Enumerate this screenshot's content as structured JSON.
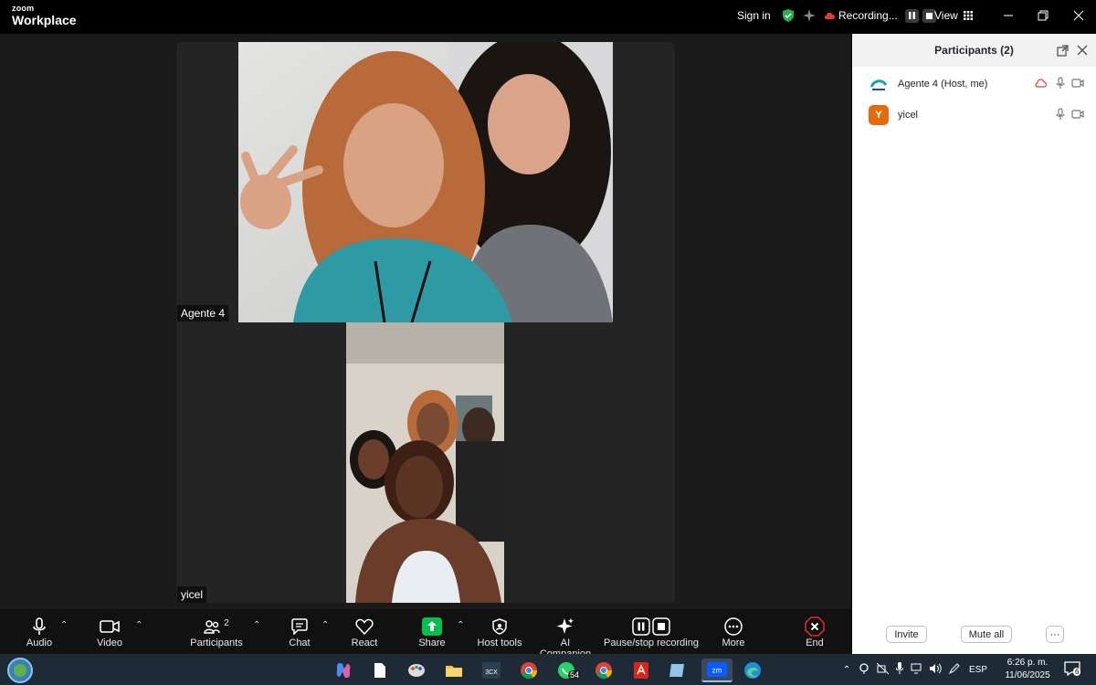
{
  "app": {
    "logo_small": "zoom",
    "logo_big": "Workplace"
  },
  "titlebar": {
    "sign_in": "Sign in",
    "recording": "Recording...",
    "view": "View"
  },
  "tiles": [
    {
      "name": "Agente 4"
    },
    {
      "name": "yicel"
    }
  ],
  "panel": {
    "title": "Participants (2)",
    "participants": [
      {
        "name": "Agente 4 (Host, me)",
        "avatar": ""
      },
      {
        "name": "yicel",
        "avatar": "Y"
      }
    ],
    "invite": "Invite",
    "mute_all": "Mute all",
    "more": "···"
  },
  "toolbar": {
    "audio": "Audio",
    "video": "Video",
    "participants": "Participants",
    "participants_count": "2",
    "chat": "Chat",
    "react": "React",
    "share": "Share",
    "host_tools": "Host tools",
    "ai_companion": "AI Companion",
    "pause_stop_recording": "Pause/stop recording",
    "more": "More",
    "end": "End"
  },
  "taskbar": {
    "whatsapp_badge": "54",
    "lang": "ESP",
    "time": "6:26 p. m.",
    "date": "11/06/2025",
    "notif_count": "6"
  },
  "colors": {
    "accent_blue": "#0b5cff",
    "end_red": "#e02828",
    "share_green": "#00c14d",
    "avatar_orange": "#e46a12"
  }
}
